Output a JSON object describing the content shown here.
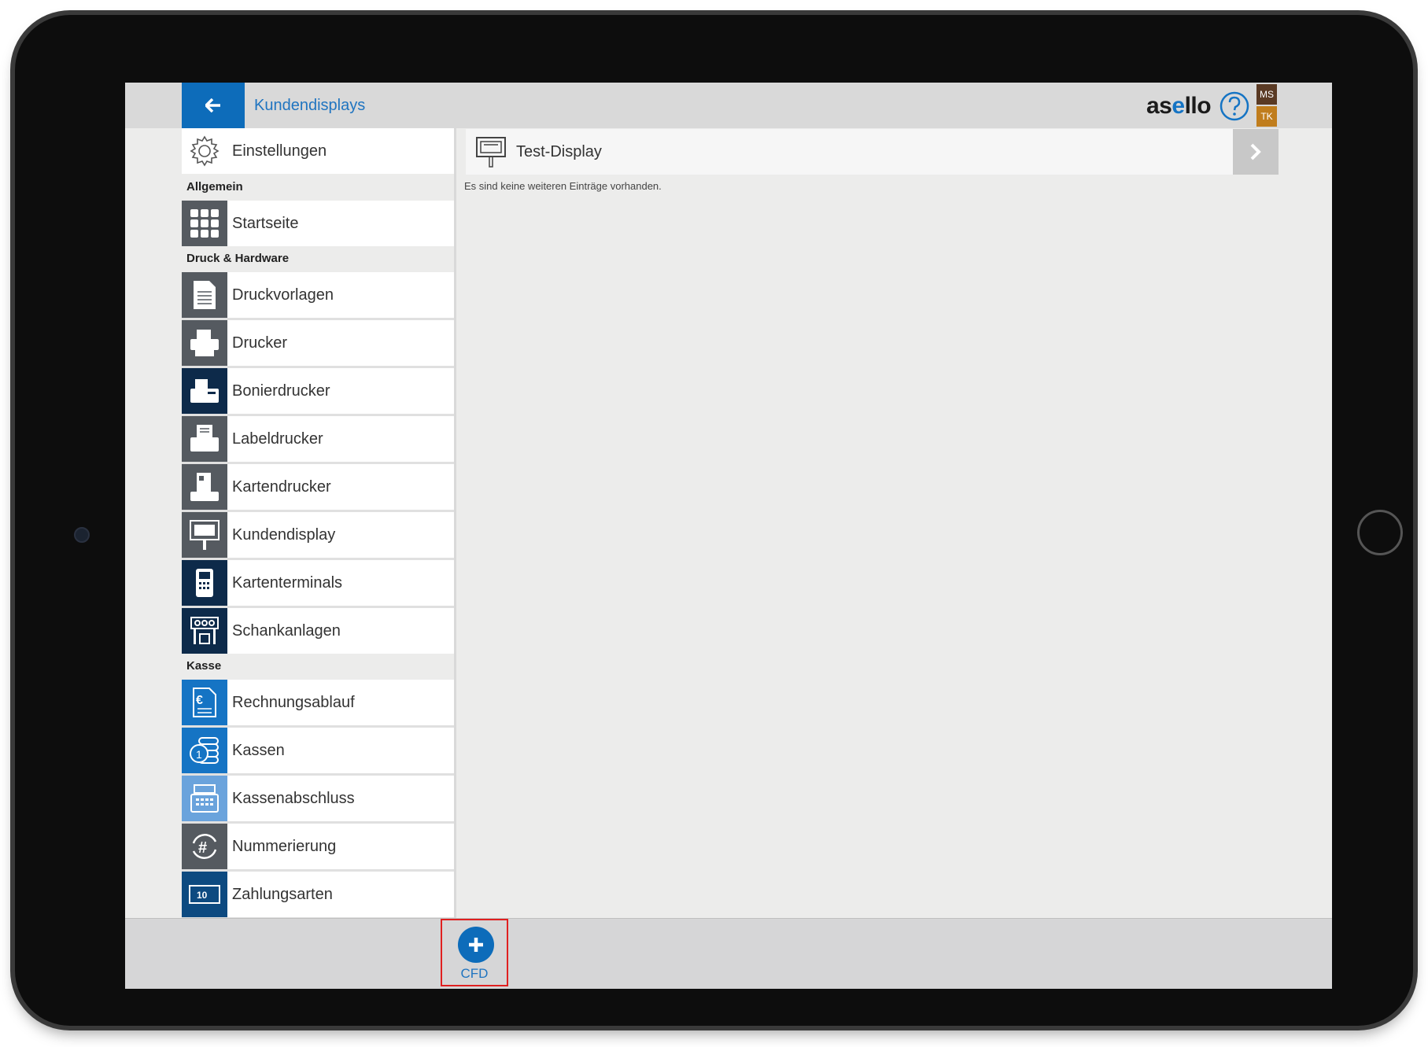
{
  "header": {
    "title": "Kundendisplays",
    "logo_prefix": "as",
    "logo_accent": "e",
    "logo_suffix": "llo",
    "badge_top": "MS",
    "badge_bottom": "TK",
    "accent_color": "#0d6cba"
  },
  "sidebar": {
    "settings_label": "Einstellungen",
    "sections": {
      "allgemein": "Allgemein",
      "druck": "Druck & Hardware",
      "kasse": "Kasse"
    },
    "items": [
      {
        "label": "Startseite",
        "icon": "grid-icon"
      },
      {
        "label": "Druckvorlagen",
        "icon": "document-icon"
      },
      {
        "label": "Drucker",
        "icon": "printer-icon"
      },
      {
        "label": "Bonierdrucker",
        "icon": "receipt-printer-icon"
      },
      {
        "label": "Labeldrucker",
        "icon": "label-printer-icon"
      },
      {
        "label": "Kartendrucker",
        "icon": "card-printer-icon"
      },
      {
        "label": "Kundendisplay",
        "icon": "customer-display-icon"
      },
      {
        "label": "Kartenterminals",
        "icon": "card-terminal-icon"
      },
      {
        "label": "Schankanlagen",
        "icon": "tap-system-icon"
      },
      {
        "label": "Rechnungsablauf",
        "icon": "invoice-euro-icon"
      },
      {
        "label": "Kassen",
        "icon": "coins-icon"
      },
      {
        "label": "Kassenabschluss",
        "icon": "cash-register-icon"
      },
      {
        "label": "Nummerierung",
        "icon": "hash-cycle-icon"
      },
      {
        "label": "Zahlungsarten",
        "icon": "banknote-icon"
      }
    ]
  },
  "main": {
    "entries": [
      {
        "label": "Test-Display"
      }
    ],
    "empty_message": "Es sind keine weiteren Einträge vorhanden."
  },
  "bottom": {
    "add_label": "CFD"
  }
}
